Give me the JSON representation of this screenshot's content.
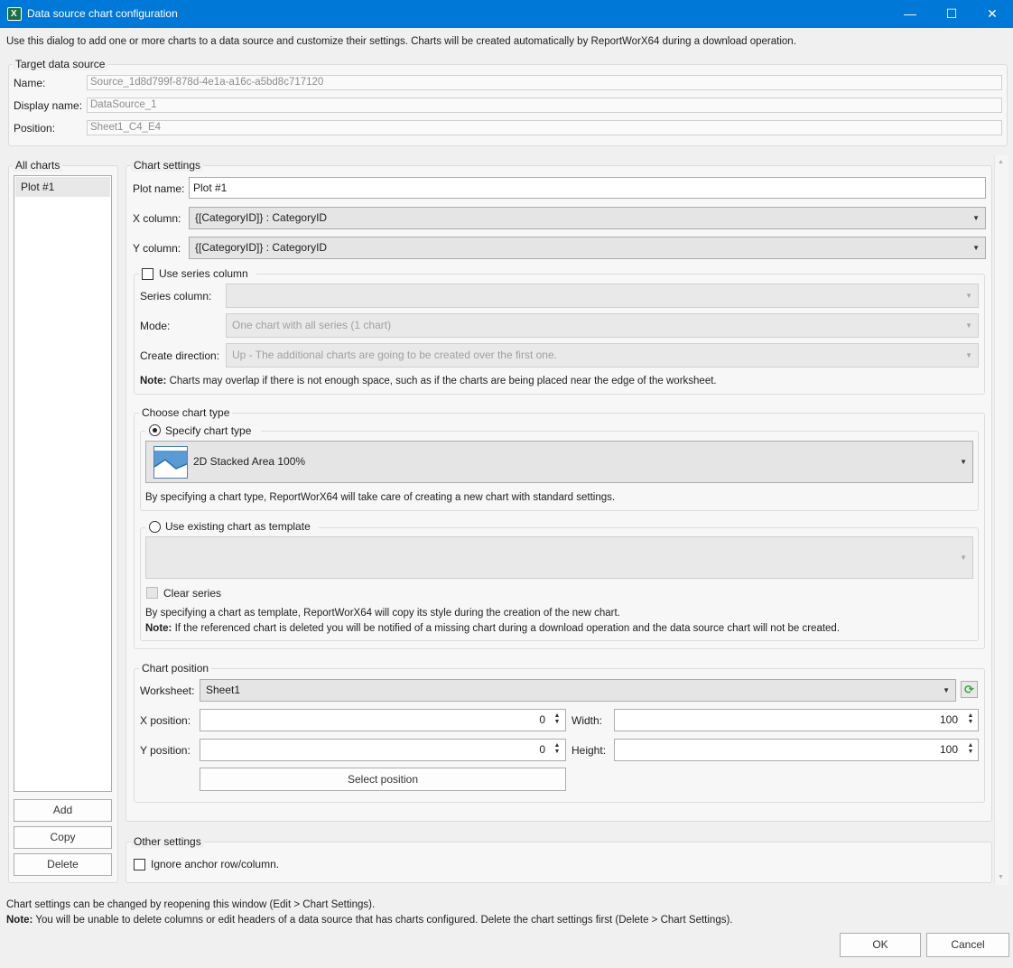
{
  "window": {
    "title": "Data source chart configuration",
    "minimize_glyph": "—",
    "maximize_glyph": "☐",
    "close_glyph": "✕"
  },
  "intro_text": "Use this dialog to add one or more charts to a data source and customize their settings. Charts will be created automatically by ReportWorX64 during a download operation.",
  "target": {
    "legend": "Target data source",
    "name_label": "Name:",
    "name_value": "Source_1d8d799f-878d-4e1a-a16c-a5bd8c717120",
    "display_label": "Display name:",
    "display_value": "DataSource_1",
    "position_label": "Position:",
    "position_value": "Sheet1_C4_E4"
  },
  "all_charts": {
    "legend": "All charts",
    "items": [
      "Plot #1"
    ],
    "add_label": "Add",
    "copy_label": "Copy",
    "delete_label": "Delete"
  },
  "chart_settings": {
    "legend": "Chart settings",
    "plot_name_label": "Plot name:",
    "plot_name_value": "Plot #1",
    "x_column_label": "X column:",
    "x_column_value": "{[CategoryID]} : CategoryID",
    "y_column_label": "Y column:",
    "y_column_value": "{[CategoryID]} : CategoryID"
  },
  "series": {
    "use_label": "Use series column",
    "series_column_label": "Series column:",
    "series_column_value": "",
    "mode_label": "Mode:",
    "mode_value": "One chart with all series (1 chart)",
    "direction_label": "Create direction:",
    "direction_value": "Up - The additional charts are going to be created over the first one.",
    "note_bold": "Note:",
    "note_text": " Charts may overlap if there is not enough space, such as if the charts are being placed near the edge of the worksheet."
  },
  "chart_type": {
    "legend": "Choose chart type",
    "specify_label": "Specify chart type",
    "selected_type": "2D Stacked Area 100%",
    "specify_description": "By specifying a chart type, ReportWorX64 will take care of creating a new chart with standard settings.",
    "template_label": "Use existing chart as template",
    "clear_series_label": "Clear series",
    "template_description": "By specifying a chart as template, ReportWorX64 will copy its style during the creation of the new chart.",
    "template_note_bold": "Note:",
    "template_note_text": " If the referenced chart is deleted you will be notified of a missing chart during a download operation and the data source chart will not be created."
  },
  "chart_position": {
    "legend": "Chart position",
    "worksheet_label": "Worksheet:",
    "worksheet_value": "Sheet1",
    "x_label": "X position:",
    "x_value": "0",
    "y_label": "Y position:",
    "y_value": "0",
    "width_label": "Width:",
    "width_value": "100",
    "height_label": "Height:",
    "height_value": "100",
    "select_position_label": "Select position"
  },
  "other_settings": {
    "legend": "Other settings",
    "ignore_anchor_label": "Ignore anchor row/column."
  },
  "footer": {
    "line1": "Chart settings can be changed by reopening this window (Edit  > Chart Settings).",
    "note_bold": "Note:",
    "note_text": " You will be unable to delete columns or edit headers of a data source that has charts configured. Delete the chart settings first (Delete > Chart Settings).",
    "ok_label": "OK",
    "cancel_label": "Cancel"
  },
  "colors": {
    "titlebar": "#0078d7",
    "accent_icon": "#4e7fa8",
    "refresh_icon": "#3aa53a"
  },
  "icons": {
    "dropdown": "▼",
    "spin_up": "▲",
    "spin_down": "▼",
    "refresh": "⟳",
    "scroll_up": "▲",
    "scroll_down": "▼"
  }
}
